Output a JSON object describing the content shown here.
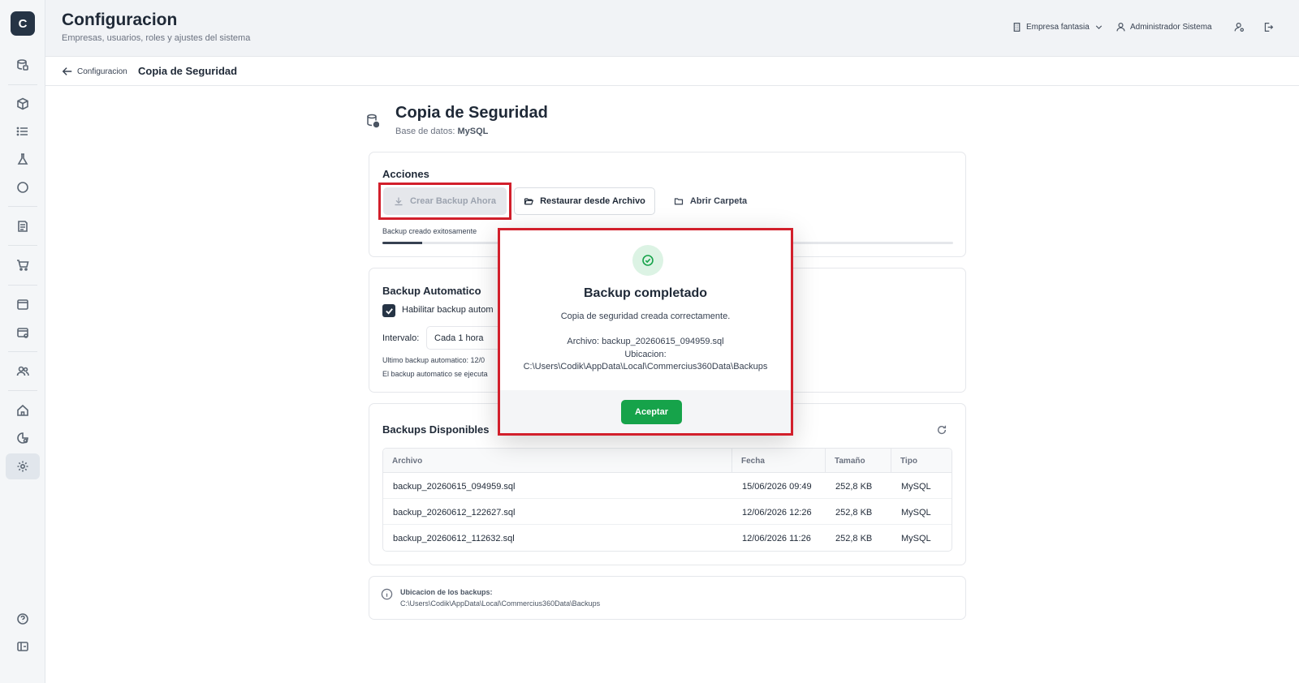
{
  "app": {
    "logo_letter": "C"
  },
  "header": {
    "title": "Configuracion",
    "subtitle": "Empresas, usuarios, roles y ajustes del sistema",
    "company": "Empresa fantasia",
    "user": "Administrador Sistema"
  },
  "breadcrumb": {
    "back_label": "Configuracion",
    "current": "Copia de Seguridad"
  },
  "page": {
    "title": "Copia de Seguridad",
    "db_label": "Base de datos:",
    "db_value": "MySQL"
  },
  "actions": {
    "title": "Acciones",
    "create_backup": "Crear Backup Ahora",
    "restore": "Restaurar desde Archivo",
    "open_folder": "Abrir Carpeta",
    "progress_label": "Backup creado exitosamente",
    "progress_fraction": 0.07
  },
  "auto_backup": {
    "title": "Backup Automatico",
    "enable_label": "Habilitar backup autom",
    "enabled": true,
    "interval_label": "Intervalo:",
    "interval_value": "Cada 1 hora",
    "last_backup": "Ultimo backup automatico: 12/0",
    "note": "El backup automatico se ejecuta"
  },
  "backups": {
    "title": "Backups Disponibles",
    "columns": [
      "Archivo",
      "Fecha",
      "Tamaño",
      "Tipo"
    ],
    "rows": [
      {
        "file": "backup_20260615_094959.sql",
        "date": "15/06/2026 09:49",
        "size": "252,8 KB",
        "type": "MySQL"
      },
      {
        "file": "backup_20260612_122627.sql",
        "date": "12/06/2026 12:26",
        "size": "252,8 KB",
        "type": "MySQL"
      },
      {
        "file": "backup_20260612_112632.sql",
        "date": "12/06/2026 11:26",
        "size": "252,8 KB",
        "type": "MySQL"
      }
    ]
  },
  "location": {
    "title": "Ubicacion de los backups:",
    "path": "C:\\Users\\Codik\\AppData\\Local\\Commercius360Data\\Backups"
  },
  "modal": {
    "title": "Backup completado",
    "message": "Copia de seguridad creada correctamente.",
    "file_line": "Archivo: backup_20260615_094959.sql",
    "location_line": "Ubicacion: C:\\Users\\Codik\\AppData\\Local\\Commercius360Data\\Backups",
    "accept": "Aceptar"
  },
  "colors": {
    "success": "#16a34a",
    "highlight": "#d21f2b",
    "sidebar_dark": "#263445"
  }
}
